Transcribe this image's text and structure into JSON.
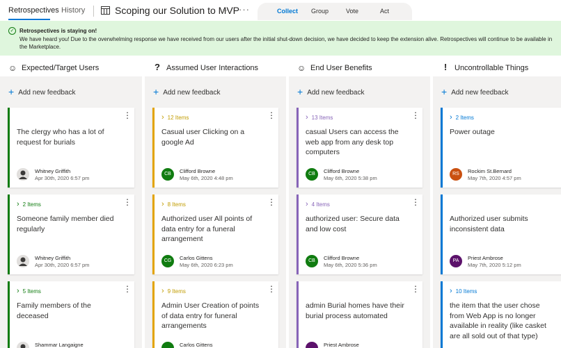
{
  "tabs": {
    "retro": "Retrospectives",
    "history": "History"
  },
  "board": {
    "title": "Scoping our Solution to MVP",
    "more": "···",
    "chevron": "⌵"
  },
  "phases": {
    "collect": "Collect",
    "group": "Group",
    "vote": "Vote",
    "act": "Act"
  },
  "banner": {
    "title": "Retrospectives is staying on!",
    "text": "We have heard you! Due to the overwhelming response we have received from our users after the initial shut-down decision, we have decided to keep the extension alive. Retrospectives will continue to be available in the Marketplace."
  },
  "add_feedback": "Add new feedback",
  "columns": [
    {
      "title": "Expected/Target Users",
      "icon": "smiley-icon",
      "glyph": "☺",
      "accent": "#107c10",
      "cards": [
        {
          "group": "",
          "text": "The clergy who  has a lot of request for burials",
          "author": "Whitney Griffith",
          "date": "Apr 30th, 2020 6:57 pm",
          "initials": "",
          "avatar_color": "#8a8886",
          "photo": true
        },
        {
          "group": "2 Items",
          "text": "Someone family member died regularly",
          "author": "Whitney Griffith",
          "date": "Apr 30th, 2020 6:57 pm",
          "initials": "",
          "avatar_color": "#8a8886",
          "photo": true
        },
        {
          "group": "5 Items",
          "text": "Family members of the deceased",
          "author": "Shammar Langaigne",
          "date": "",
          "initials": "",
          "avatar_color": "#c8c6c4",
          "photo": true
        }
      ]
    },
    {
      "title": "Assumed User Interactions",
      "icon": "question-icon",
      "glyph": "?",
      "accent": "#e3a400",
      "cards": [
        {
          "group": "12 Items",
          "text": "Casual user Clicking on a google Ad",
          "author": "Clifford Browne",
          "date": "May 6th, 2020 4:48 pm",
          "initials": "CB",
          "avatar_color": "#107c10"
        },
        {
          "group": "8 Items",
          "text": "Authorized  user All points of data entry for a funeral arrangement",
          "author": "Carlos Gittens",
          "date": "May 6th, 2020 6:23 pm",
          "initials": "CG",
          "avatar_color": "#107c10"
        },
        {
          "group": "9 Items",
          "text": "Admin User Creation of points of data entry for funeral arrangements",
          "author": "Carlos Gittens",
          "date": "",
          "initials": "",
          "avatar_color": "#107c10"
        }
      ]
    },
    {
      "title": "End User Benefits",
      "icon": "smiley-icon",
      "glyph": "☺",
      "accent": "#8764b8",
      "cards": [
        {
          "group": "13 Items",
          "text": "casual Users can access the web app from any desk top computers",
          "author": "Clifford Browne",
          "date": "May 6th, 2020 5:38 pm",
          "initials": "CB",
          "avatar_color": "#107c10"
        },
        {
          "group": "4 Items",
          "text": "authorized user: Secure data and low cost",
          "author": "Clifford Browne",
          "date": "May 6th, 2020 5:36 pm",
          "initials": "CB",
          "avatar_color": "#107c10"
        },
        {
          "group": "",
          "text": "admin Burial homes have their burial process automated",
          "author": "Priest Ambrose",
          "date": "",
          "initials": "",
          "avatar_color": "#5c126b"
        }
      ]
    },
    {
      "title": "Uncontrollable Things",
      "icon": "exclamation-icon",
      "glyph": "!",
      "accent": "#0078d4",
      "cards": [
        {
          "group": "2 Items",
          "text": "Power outage",
          "author": "Rockim St.Bernard",
          "date": "May 7th, 2020 4:57 pm",
          "initials": "RS",
          "avatar_color": "#ca5010"
        },
        {
          "group": "",
          "text": "Authorized user submits inconsistent data",
          "author": "Priest Ambrose",
          "date": "May 7th, 2020 5:12 pm",
          "initials": "PA",
          "avatar_color": "#5c126b"
        },
        {
          "group": "10 Items",
          "text": "the item that the user chose from Web App is no longer available in reality (like casket are all sold out of that type)",
          "author": "",
          "date": "",
          "initials": "",
          "avatar_color": "#0078d4"
        }
      ]
    }
  ]
}
